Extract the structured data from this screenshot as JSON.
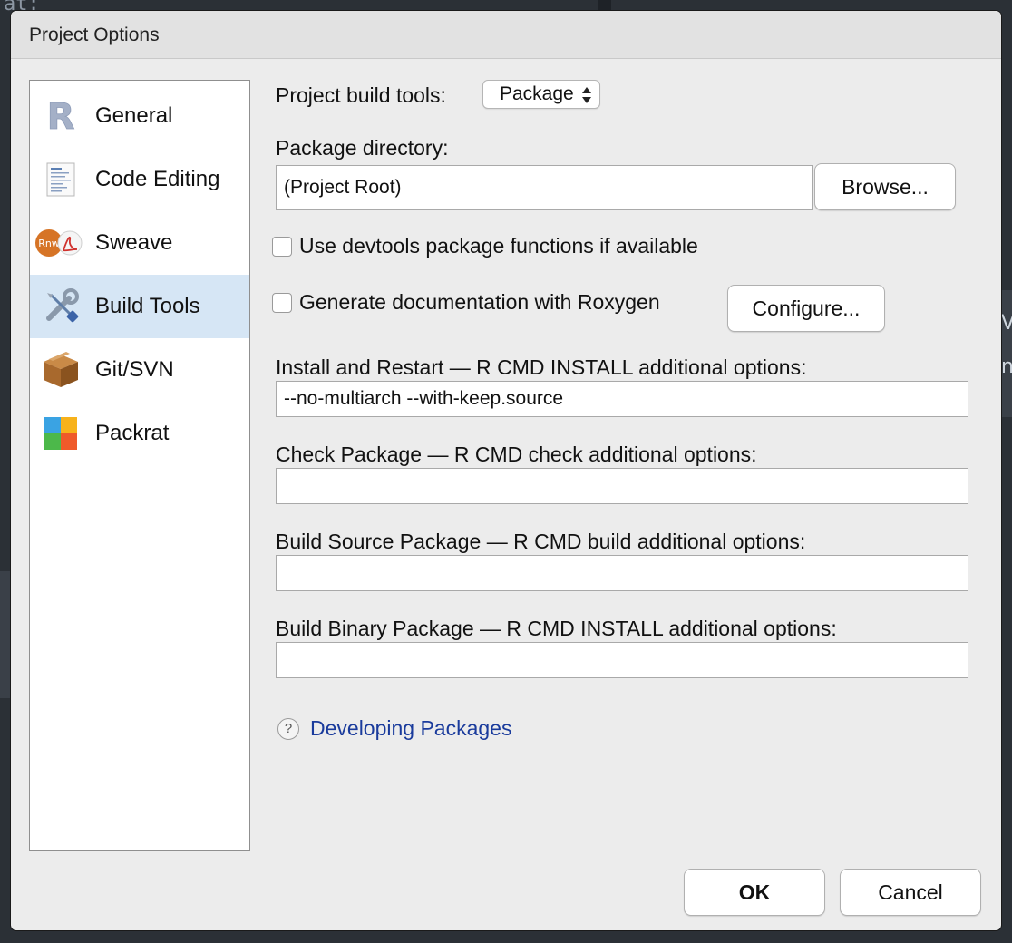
{
  "background": {
    "code_fragment": "at:",
    "side_fragment_1": "Vi",
    "side_fragment_2": "n"
  },
  "dialog": {
    "title": "Project Options"
  },
  "sidebar": {
    "items": [
      {
        "label": "General",
        "icon": "r-logo-icon",
        "selected": false
      },
      {
        "label": "Code Editing",
        "icon": "code-document-icon",
        "selected": false
      },
      {
        "label": "Sweave",
        "icon": "rnw-pdf-icon",
        "selected": false
      },
      {
        "label": "Build Tools",
        "icon": "wrench-screwdriver-icon",
        "selected": true
      },
      {
        "label": "Git/SVN",
        "icon": "box-icon",
        "selected": false
      },
      {
        "label": "Packrat",
        "icon": "packrat-icon",
        "selected": false
      }
    ]
  },
  "build_tools": {
    "project_build_tools_label": "Project build tools:",
    "project_build_tools_value": "Package",
    "package_directory_label": "Package directory:",
    "package_directory_value": "(Project Root)",
    "browse_label": "Browse...",
    "use_devtools_label": "Use devtools package functions if available",
    "use_devtools_checked": false,
    "roxygen_label": "Generate documentation with Roxygen",
    "roxygen_checked": false,
    "configure_label": "Configure...",
    "install_label": "Install and Restart — R CMD INSTALL additional options:",
    "install_value": "--no-multiarch --with-keep.source",
    "check_label": "Check Package — R CMD check additional options:",
    "check_value": "",
    "build_source_label": "Build Source Package — R CMD build additional options:",
    "build_source_value": "",
    "build_binary_label": "Build Binary Package — R CMD INSTALL additional options:",
    "build_binary_value": "",
    "help_link_label": "Developing Packages",
    "help_icon_text": "?"
  },
  "footer": {
    "ok_label": "OK",
    "cancel_label": "Cancel"
  },
  "colors": {
    "selected_bg": "#d6e6f5",
    "link": "#1a3b9c",
    "dialog_bg": "#ececec"
  }
}
